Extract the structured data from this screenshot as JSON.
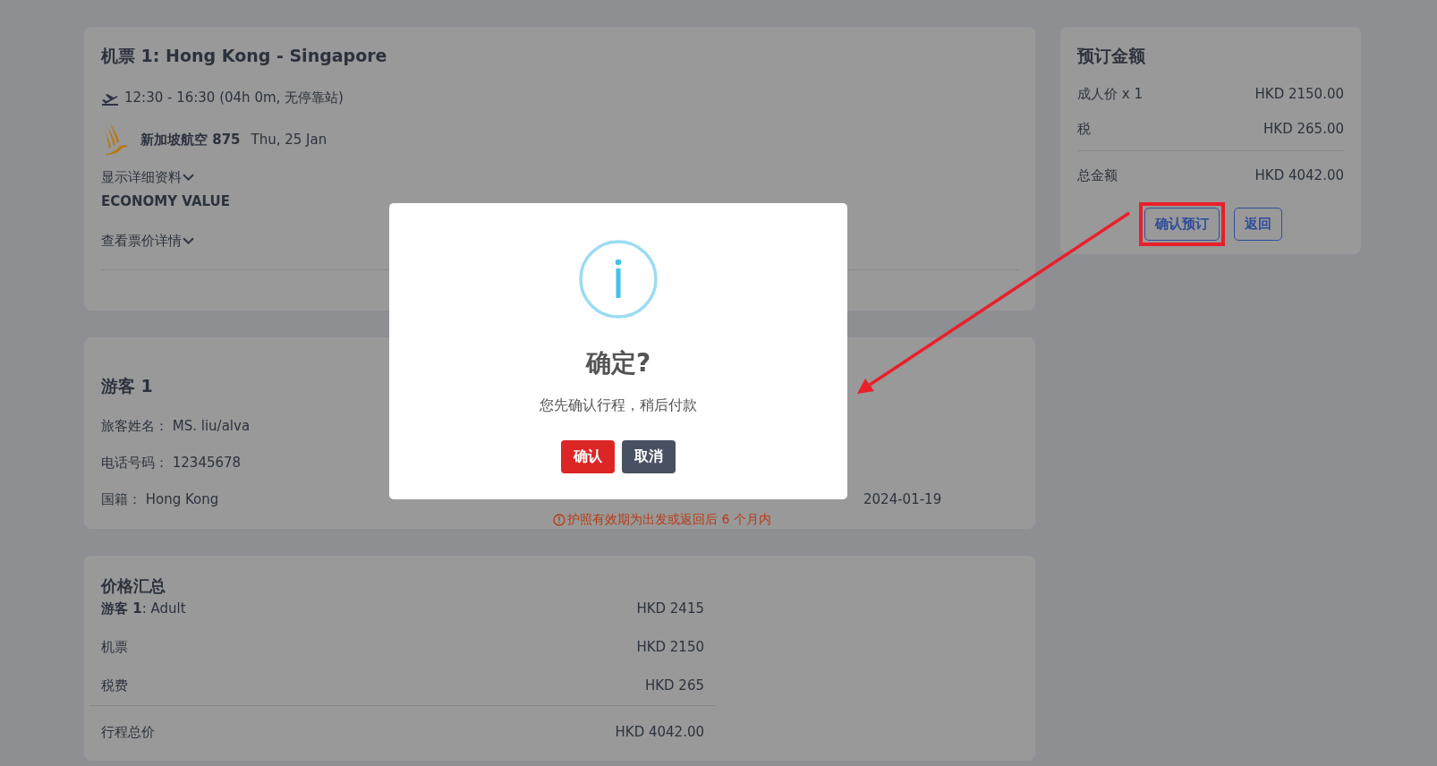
{
  "flight": {
    "title": "机票 1: Hong Kong - Singapore",
    "time": "12:30 - 16:30 (04h 0m, 无停靠站)",
    "airline": "新加坡航空 875",
    "date": "Thu, 25 Jan",
    "details_toggle": {
      "label": "显示详细资料",
      "expanded": false
    },
    "cabin": "ECONOMY VALUE",
    "fare_toggle": {
      "label": "查看票价详情",
      "expanded": false
    }
  },
  "passenger": {
    "title": "游客 1",
    "fields": [
      {
        "label": "旅客姓名：",
        "value": "MS. liu/alva"
      },
      {
        "label": "电话号码：",
        "value": "12345678"
      },
      {
        "label": "国籍：",
        "value": "Hong Kong"
      }
    ],
    "expiry": "2024-01-19",
    "warning": "护照有效期为出发或返回后 6 个月内"
  },
  "price_summary": {
    "title": "价格汇总",
    "rows": [
      {
        "kind": "header",
        "label": "**游客 1**: Adult",
        "value": "HKD 2415"
      },
      {
        "kind": "item",
        "label": "机票",
        "value": "HKD 2150"
      },
      {
        "kind": "item",
        "label": "税费",
        "value": "HKD 265"
      },
      {
        "kind": "total",
        "label": "行程总价",
        "value": "HKD 4042.00"
      }
    ]
  },
  "booking_amount": {
    "title": "预订金额",
    "rows": [
      {
        "kind": "item",
        "label": "成人价 x 1",
        "value": "HKD 2150.00"
      },
      {
        "kind": "item",
        "label": "税",
        "value": "HKD 265.00"
      },
      {
        "kind": "total",
        "label": "总金额",
        "value": "HKD 4042.00"
      }
    ],
    "buttons": [
      {
        "label": "确认预订",
        "highlighted": true
      },
      {
        "label": "返回",
        "highlighted": false
      }
    ]
  },
  "dialog": {
    "title": "确定?",
    "message": "您先确认行程，稍后付款",
    "buttons": [
      {
        "label": "确认",
        "kind": "confirm"
      },
      {
        "label": "取消",
        "kind": "cancel"
      }
    ]
  }
}
